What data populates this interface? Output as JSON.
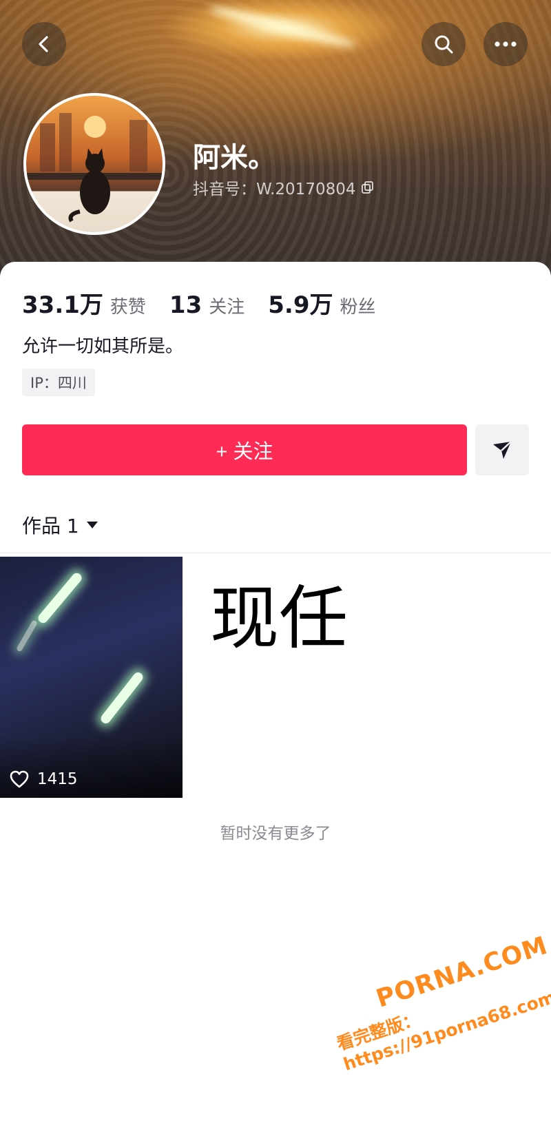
{
  "header": {
    "name": "阿米。",
    "douyin_id": "抖音号：W.20170804"
  },
  "stats": [
    {
      "value": "33.1万",
      "label": "获赞"
    },
    {
      "value": "13",
      "label": "关注"
    },
    {
      "value": "5.9万",
      "label": "粉丝"
    }
  ],
  "bio": "允许一切如其所是。",
  "ip_tag": "IP：四川",
  "actions": {
    "follow_label": "+ 关注"
  },
  "works": {
    "tab_label": "作品 1",
    "items": [
      {
        "likes": "1415",
        "caption": "现任"
      }
    ],
    "end_text": "暂时没有更多了"
  },
  "watermark": {
    "line1": "PORNA.COM",
    "line2": "看完整版：https://91porna68.com"
  },
  "colors": {
    "accent": "#fe2c55"
  }
}
